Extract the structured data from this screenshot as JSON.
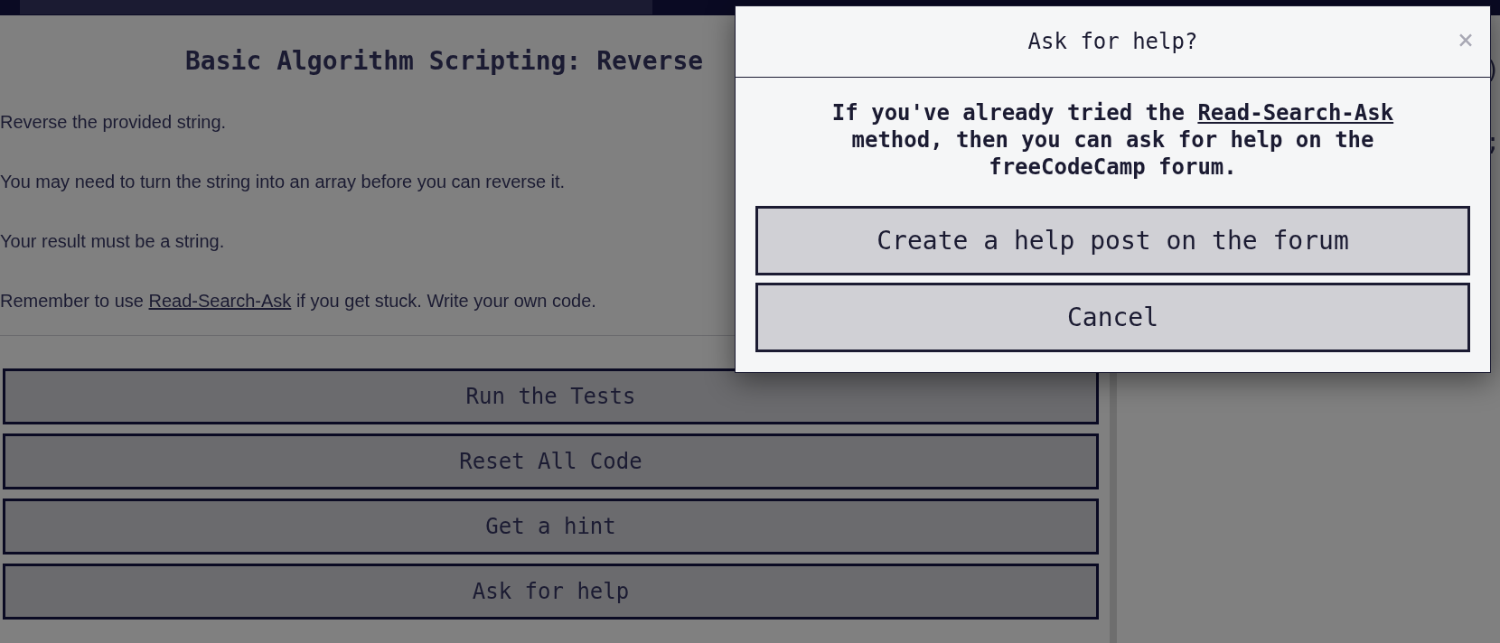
{
  "challenge": {
    "title": "Basic Algorithm Scripting: Reverse",
    "paragraphs": [
      {
        "text": "Reverse the provided string."
      },
      {
        "text": "You may need to turn the string into an array before you can reverse it."
      },
      {
        "text": "Your result must be a string."
      },
      {
        "text": "Remember to use ",
        "link": "Read-Search-Ask",
        "after": " if you get stuck. Write your own code."
      }
    ],
    "buttons": [
      "Run the Tests",
      "Reset All Code",
      "Get a hint",
      "Ask for help"
    ]
  },
  "editor_fragments": [
    ")",
    ";"
  ],
  "modal": {
    "title": "Ask for help?",
    "close": "×",
    "message": {
      "text": "If you've already tried the ",
      "link": "Read-Search-Ask",
      "after": " method, then you can ask for help on the freeCodeCamp forum."
    },
    "buttons": [
      "Create a help post on the forum",
      "Cancel"
    ]
  }
}
